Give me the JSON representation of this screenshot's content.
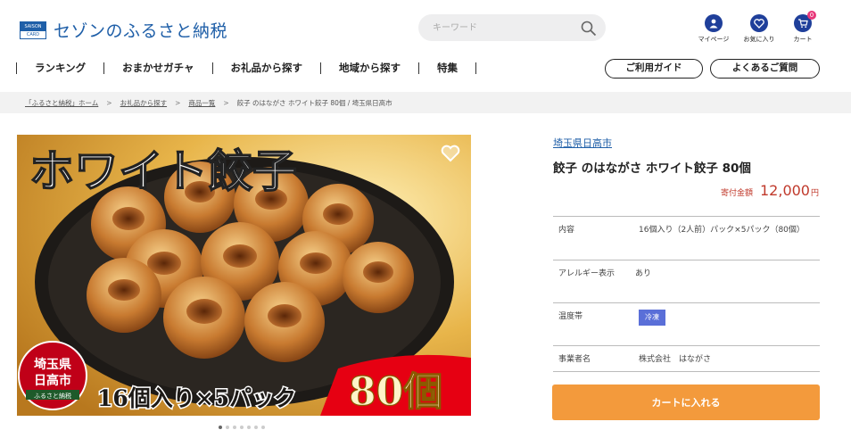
{
  "header": {
    "logo_card_top": "SAISON",
    "logo_card_bottom": "CARD",
    "logo_text": "セゾンのふるさと納税",
    "search_placeholder": "キーワード",
    "icons": [
      {
        "label": "マイページ",
        "icon": "user-icon"
      },
      {
        "label": "お気に入り",
        "icon": "heart-icon"
      },
      {
        "label": "カート",
        "icon": "cart-icon",
        "badge": "0"
      }
    ]
  },
  "nav": {
    "items": [
      "ランキング",
      "おまかせガチャ",
      "お礼品から探す",
      "地域から探す",
      "特集"
    ],
    "guide_label": "ご利用ガイド",
    "faq_label": "よくあるご質問"
  },
  "breadcrumb": {
    "items": [
      "「ふるさと納税」ホーム",
      "お礼品から探す",
      "商品一覧"
    ],
    "current": "餃子 のはながさ ホワイト餃子 80個 / 埼玉県日高市"
  },
  "photo": {
    "headline": "ホワイト餃子",
    "pack": "16個入り×5パック",
    "count": "80個",
    "seal_line1": "埼玉県",
    "seal_line2": "日高市",
    "seal_line3": "ふるさと納税"
  },
  "product": {
    "region": "埼玉県日高市",
    "title": "餃子 のはながさ ホワイト餃子 80個",
    "price_label": "寄付金額",
    "price_value": "12,000",
    "price_unit": "円",
    "specs": [
      {
        "key": "内容",
        "value": "16個入り（2人前）パック×5パック（80個）"
      },
      {
        "key": "アレルギー表示",
        "value": "あり"
      },
      {
        "key": "温度帯",
        "value": "冷凍"
      },
      {
        "key": "事業者名",
        "value": "株式会社　はながさ"
      }
    ],
    "cart_button": "カートに入れる"
  },
  "colors": {
    "brand": "#1f5fa8",
    "price": "#c0392b",
    "cart": "#f39a3c",
    "temp_tag": "#5a6fd8"
  }
}
